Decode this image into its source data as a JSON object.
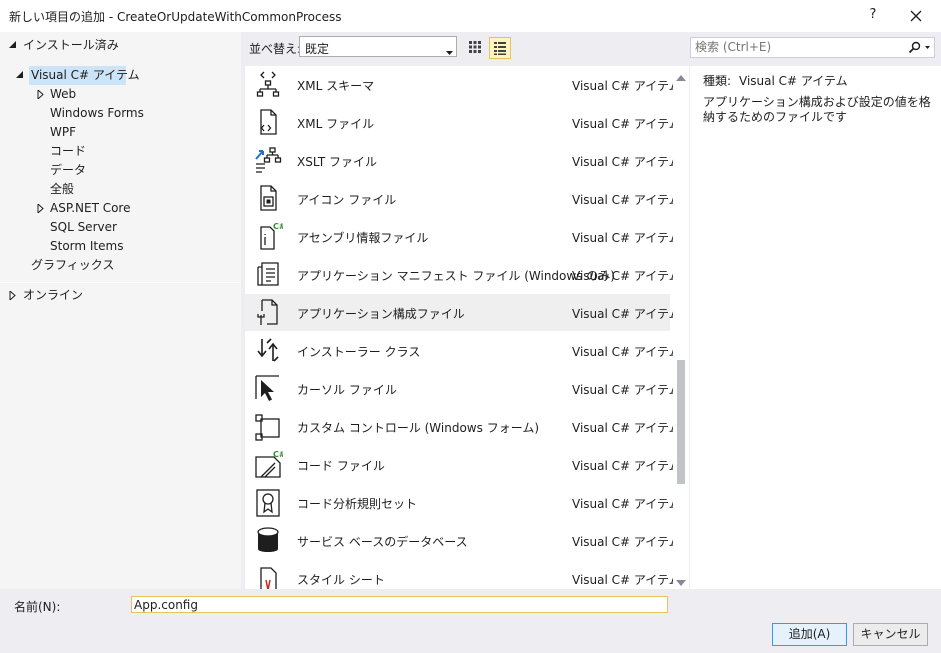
{
  "window": {
    "title": "新しい項目の追加 - CreateOrUpdateWithCommonProcess",
    "help_label": "?",
    "close_icon": "close-icon"
  },
  "tree": {
    "installed": "インストール済み",
    "visual_csharp": "Visual C# アイテム",
    "children": [
      "Web",
      "Windows Forms",
      "WPF",
      "コード",
      "データ",
      "全般",
      "ASP.NET Core",
      "SQL Server",
      "Storm Items"
    ],
    "graphics": "グラフィックス",
    "online": "オンライン"
  },
  "toolbar": {
    "sort_label": "並べ替え:",
    "sort_value": "既定",
    "grid_icon": "grid-view-icon",
    "list_icon": "list-view-icon"
  },
  "search": {
    "placeholder": "検索 (Ctrl+E)",
    "icon": "search-icon"
  },
  "items": [
    {
      "name": "XML スキーマ",
      "category": "Visual C# アイテム",
      "icon": "xml-schema-icon"
    },
    {
      "name": "XML ファイル",
      "category": "Visual C# アイテム",
      "icon": "xml-file-icon"
    },
    {
      "name": "XSLT ファイル",
      "category": "Visual C# アイテム",
      "icon": "xslt-file-icon"
    },
    {
      "name": "アイコン ファイル",
      "category": "Visual C# アイテム",
      "icon": "icon-file-icon"
    },
    {
      "name": "アセンブリ情報ファイル",
      "category": "Visual C# アイテム",
      "icon": "assembly-info-icon"
    },
    {
      "name": "アプリケーション マニフェスト ファイル (Windows のみ)",
      "category": "Visual C# アイテム",
      "icon": "manifest-icon"
    },
    {
      "name": "アプリケーション構成ファイル",
      "category": "Visual C# アイテム",
      "icon": "config-file-icon"
    },
    {
      "name": "インストーラー クラス",
      "category": "Visual C# アイテム",
      "icon": "installer-class-icon"
    },
    {
      "name": "カーソル ファイル",
      "category": "Visual C# アイテム",
      "icon": "cursor-file-icon"
    },
    {
      "name": "カスタム コントロール (Windows フォーム)",
      "category": "Visual C# アイテム",
      "icon": "custom-control-icon"
    },
    {
      "name": "コード ファイル",
      "category": "Visual C# アイテム",
      "icon": "code-file-icon"
    },
    {
      "name": "コード分析規則セット",
      "category": "Visual C# アイテム",
      "icon": "ruleset-icon"
    },
    {
      "name": "サービス ベースのデータベース",
      "category": "Visual C# アイテム",
      "icon": "database-icon"
    },
    {
      "name": "スタイル シート",
      "category": "Visual C# アイテム",
      "icon": "stylesheet-icon"
    }
  ],
  "selected_index": 6,
  "details": {
    "type_label": "種類:",
    "type_value": "Visual C# アイテム",
    "description": "アプリケーション構成および設定の値を格納するためのファイルです"
  },
  "bottom": {
    "name_label": "名前(N):",
    "name_value": "App.config",
    "add_label": "追加(A)",
    "cancel_label": "キャンセル"
  }
}
